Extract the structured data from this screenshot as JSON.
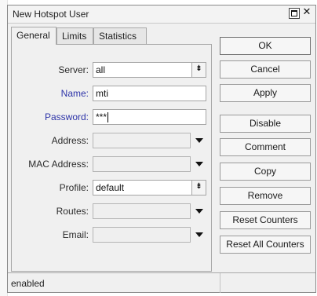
{
  "window": {
    "title": "New Hotspot User"
  },
  "tabs": [
    {
      "label": "General",
      "active": true
    },
    {
      "label": "Limits",
      "active": false
    },
    {
      "label": "Statistics",
      "active": false
    }
  ],
  "form": {
    "server": {
      "label": "Server:",
      "value": "all"
    },
    "name": {
      "label": "Name:",
      "value": "mti"
    },
    "password": {
      "label": "Password:",
      "value": "***"
    },
    "address": {
      "label": "Address:",
      "value": ""
    },
    "mac_address": {
      "label": "MAC Address:",
      "value": ""
    },
    "profile": {
      "label": "Profile:",
      "value": "default"
    },
    "routes": {
      "label": "Routes:",
      "value": ""
    },
    "email": {
      "label": "Email:",
      "value": ""
    }
  },
  "buttons": {
    "ok": "OK",
    "cancel": "Cancel",
    "apply": "Apply",
    "disable": "Disable",
    "comment": "Comment",
    "copy": "Copy",
    "remove": "Remove",
    "reset_counters": "Reset Counters",
    "reset_all_counters": "Reset All Counters"
  },
  "status": {
    "text": "enabled"
  },
  "colors": {
    "label_blue": "#2d33a8"
  }
}
